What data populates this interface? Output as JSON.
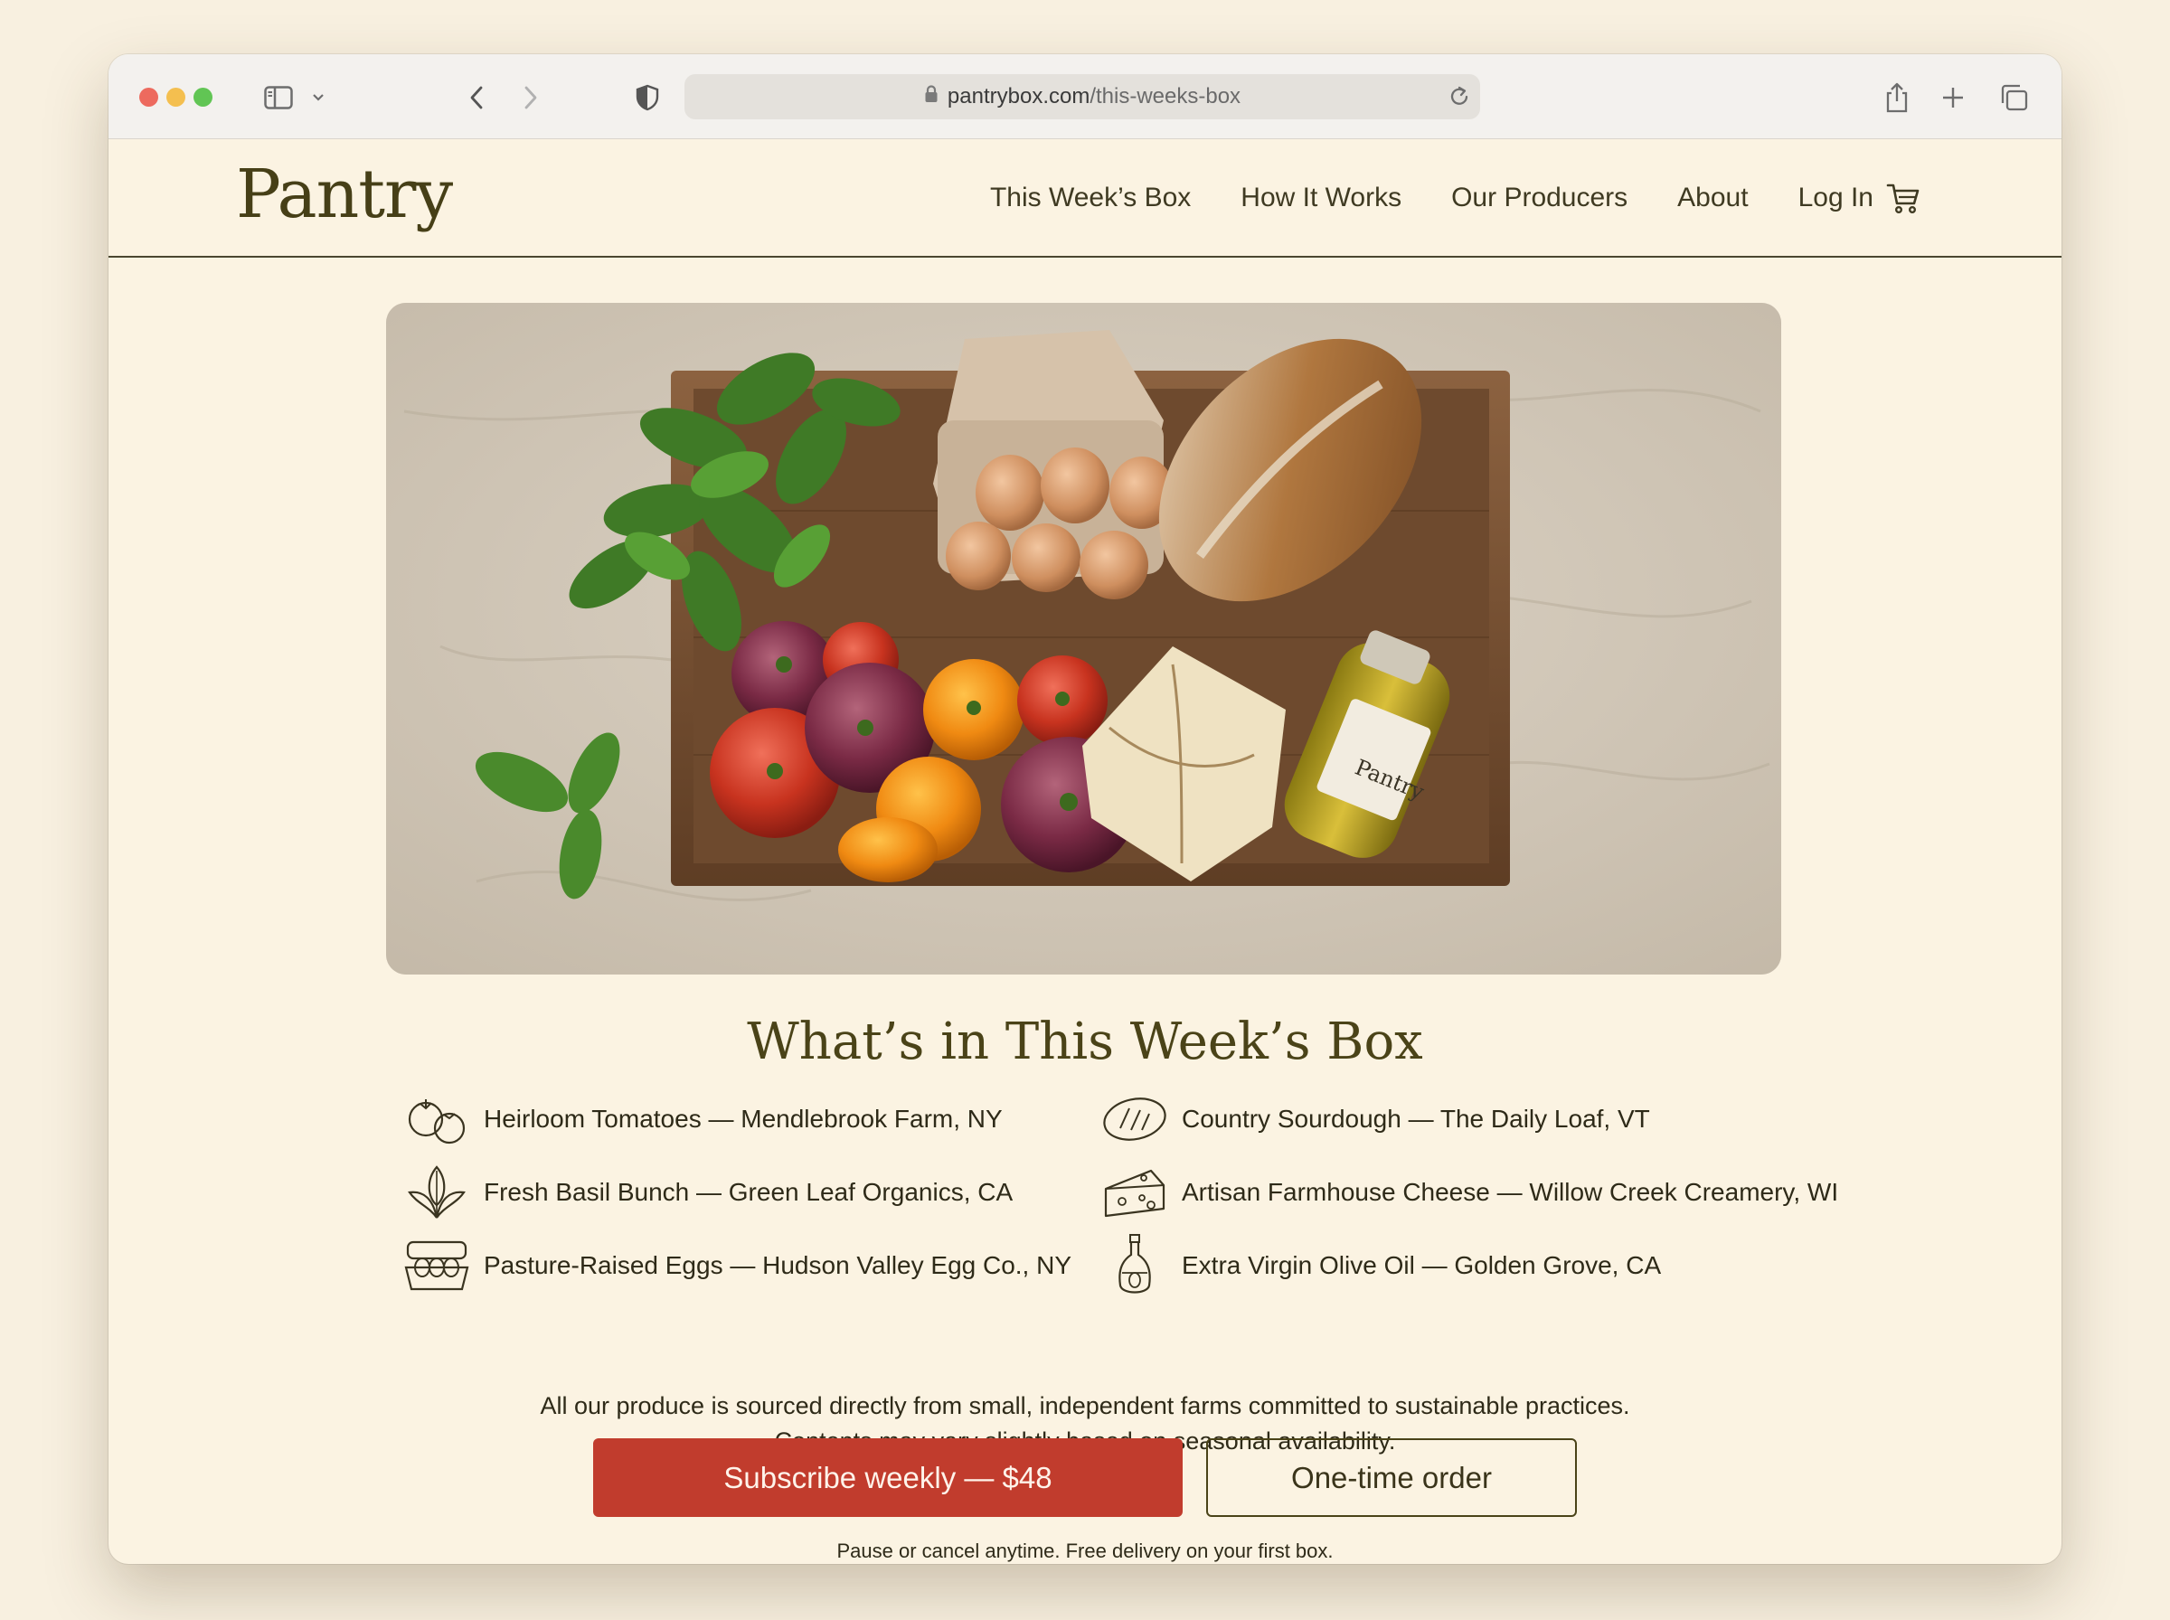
{
  "browser": {
    "url_domain": "pantrybox.com",
    "url_path": "/this-weeks-box"
  },
  "site": {
    "logo": "Pantry",
    "nav": [
      "This Week’s Box",
      "How It Works",
      "Our Producers",
      "About",
      "Log In"
    ]
  },
  "hero": {
    "jar_label": "Pantry"
  },
  "box": {
    "title": "What’s in This Week’s Box",
    "items": [
      {
        "icon": "tomato-icon",
        "text": "Heirloom Tomatoes — Mendlebrook Farm, NY"
      },
      {
        "icon": "basil-icon",
        "text": "Fresh Basil Bunch — Green Leaf Organics, CA"
      },
      {
        "icon": "egg-carton-icon",
        "text": "Pasture-Raised Eggs — Hudson Valley Egg Co., NY"
      },
      {
        "icon": "bread-icon",
        "text": "Country Sourdough — The Daily Loaf, VT"
      },
      {
        "icon": "cheese-icon",
        "text": "Artisan Farmhouse Cheese — Willow Creek Creamery, WI"
      },
      {
        "icon": "olive-oil-icon",
        "text": "Extra Virgin Olive Oil — Golden Grove, CA"
      }
    ],
    "note_line1": "All our produce is sourced directly from small, independent farms committed to sustainable practices.",
    "note_line2": "Contents may vary slightly based on seasonal availability."
  },
  "cta": {
    "subscribe_label": "Subscribe weekly — $48",
    "one_time_label": "One-time order",
    "fineprint": "Pause or cancel anytime. Free delivery on your first box."
  },
  "colors": {
    "page_bg": "#fbf3e2",
    "brand_text": "#463f17",
    "primary_button": "#c13c2d"
  }
}
